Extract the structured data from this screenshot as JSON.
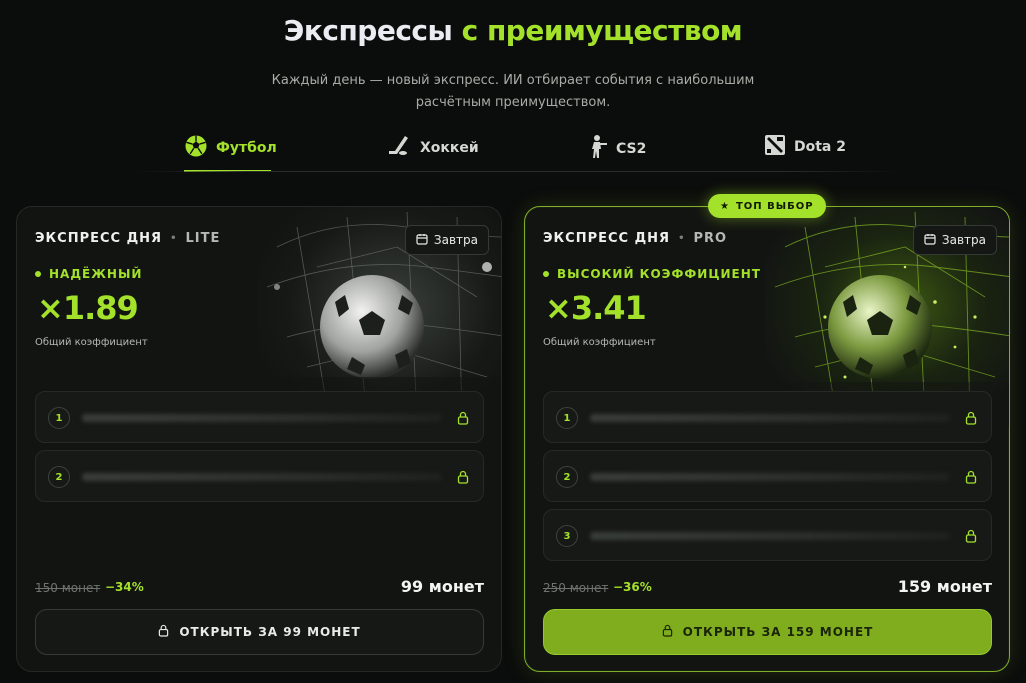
{
  "page": {
    "title_part1": "Экспрессы",
    "title_part2": "с преимуществом",
    "subtitle": "Каждый день — новый экспресс. ИИ отбирает события с наибольшим расчётным преимуществом."
  },
  "tabs": [
    {
      "label": "Футбол",
      "icon": "soccer-ball-icon",
      "active": true
    },
    {
      "label": "Хоккей",
      "icon": "hockey-stick-icon",
      "active": false
    },
    {
      "label": "CS2",
      "icon": "cs2-soldier-icon",
      "active": false
    },
    {
      "label": "Dota 2",
      "icon": "dota2-logo-icon",
      "active": false
    }
  ],
  "colors": {
    "accent": "#a3e12a",
    "background": "#0b0c0c",
    "card": "#121412"
  },
  "cards": [
    {
      "heading": "ЭКСПРЕСС ДНЯ",
      "tier": "LITE",
      "date_label": "Завтра",
      "level": "НАДЁЖНЫЙ",
      "coefficient": "×1.89",
      "coefficient_label": "Общий коэффициент",
      "events": [
        {
          "num": "1"
        },
        {
          "num": "2"
        }
      ],
      "old_price": "150 монет",
      "discount": "−34%",
      "price": "99 монет",
      "button_label": "ОТКРЫТЬ ЗА 99 МОНЕТ"
    },
    {
      "badge": "ТОП ВЫБОР",
      "heading": "ЭКСПРЕСС ДНЯ",
      "tier": "PRO",
      "date_label": "Завтра",
      "level": "ВЫСОКИЙ КОЭФФИЦИЕНТ",
      "coefficient": "×3.41",
      "coefficient_label": "Общий коэффициент",
      "events": [
        {
          "num": "1"
        },
        {
          "num": "2"
        },
        {
          "num": "3"
        }
      ],
      "old_price": "250 монет",
      "discount": "−36%",
      "price": "159 монет",
      "button_label": "ОТКРЫТЬ ЗА 159 МОНЕТ"
    }
  ]
}
